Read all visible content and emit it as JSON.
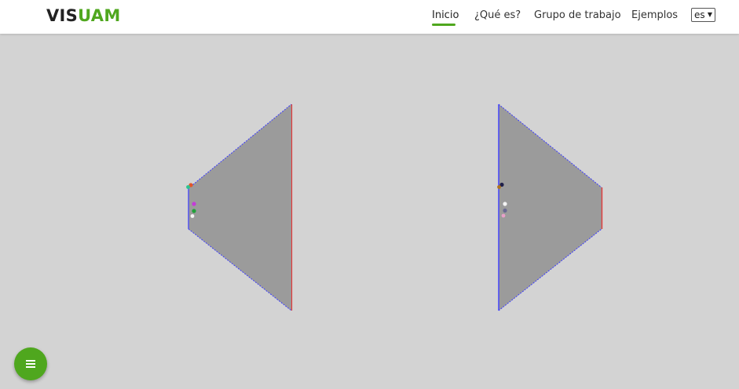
{
  "colors": {
    "accent": "#4fa71e",
    "background": "#d3d3d3",
    "shape_fill": "#9b9b9b",
    "edge_blue": "#3b3bff",
    "edge_red": "#e03a3a"
  },
  "header": {
    "brand_part1": "VIS",
    "brand_part2": "UAM",
    "nav": {
      "inicio": "Inicio",
      "que_es": "¿Qué es?",
      "grupo": "Grupo de trabajo",
      "ejemplos": "Ejemplos"
    },
    "language_select": {
      "selected": "es",
      "icon": "chevron-down-icon"
    }
  },
  "fab": {
    "icon": "menu-icon"
  }
}
